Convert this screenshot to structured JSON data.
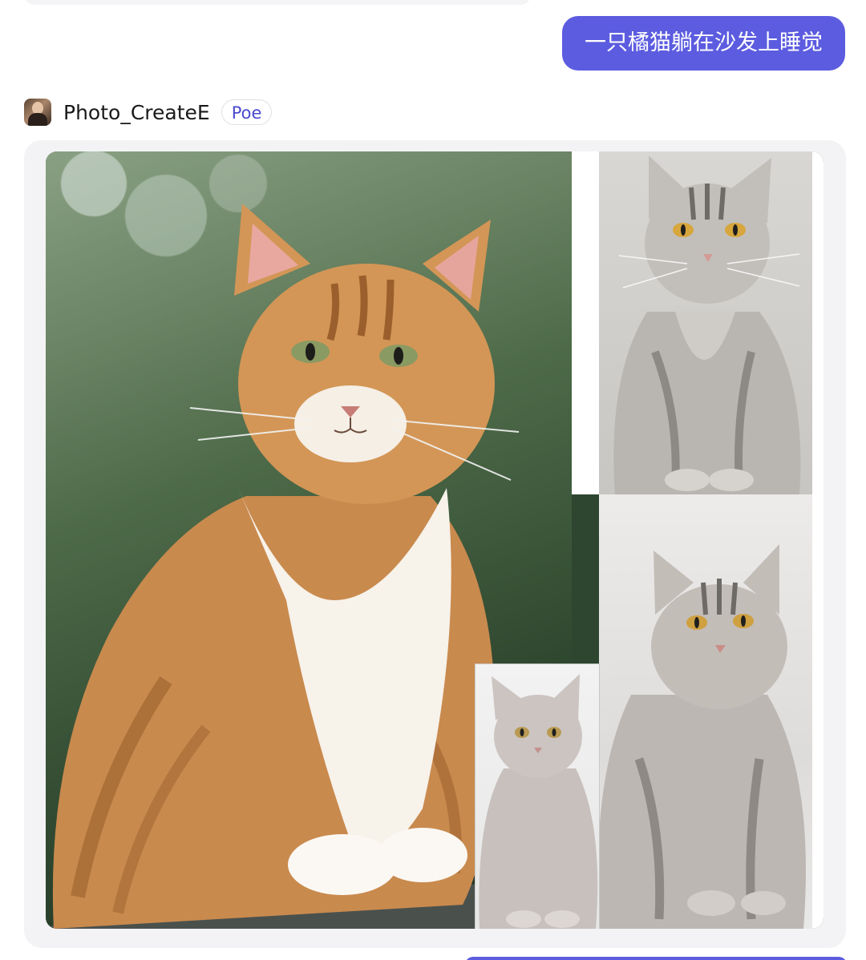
{
  "user_message": {
    "text": "一只橘猫躺在沙发上睡觉"
  },
  "bot": {
    "name": "Photo_CreateE",
    "badge": "Poe",
    "avatar_icon": "portrait-avatar"
  },
  "response": {
    "image_alt": "cat-collage-image"
  },
  "colors": {
    "user_bubble": "#5c5ce0",
    "badge_text": "#4a4ad0",
    "card_background": "#f3f3f5"
  }
}
